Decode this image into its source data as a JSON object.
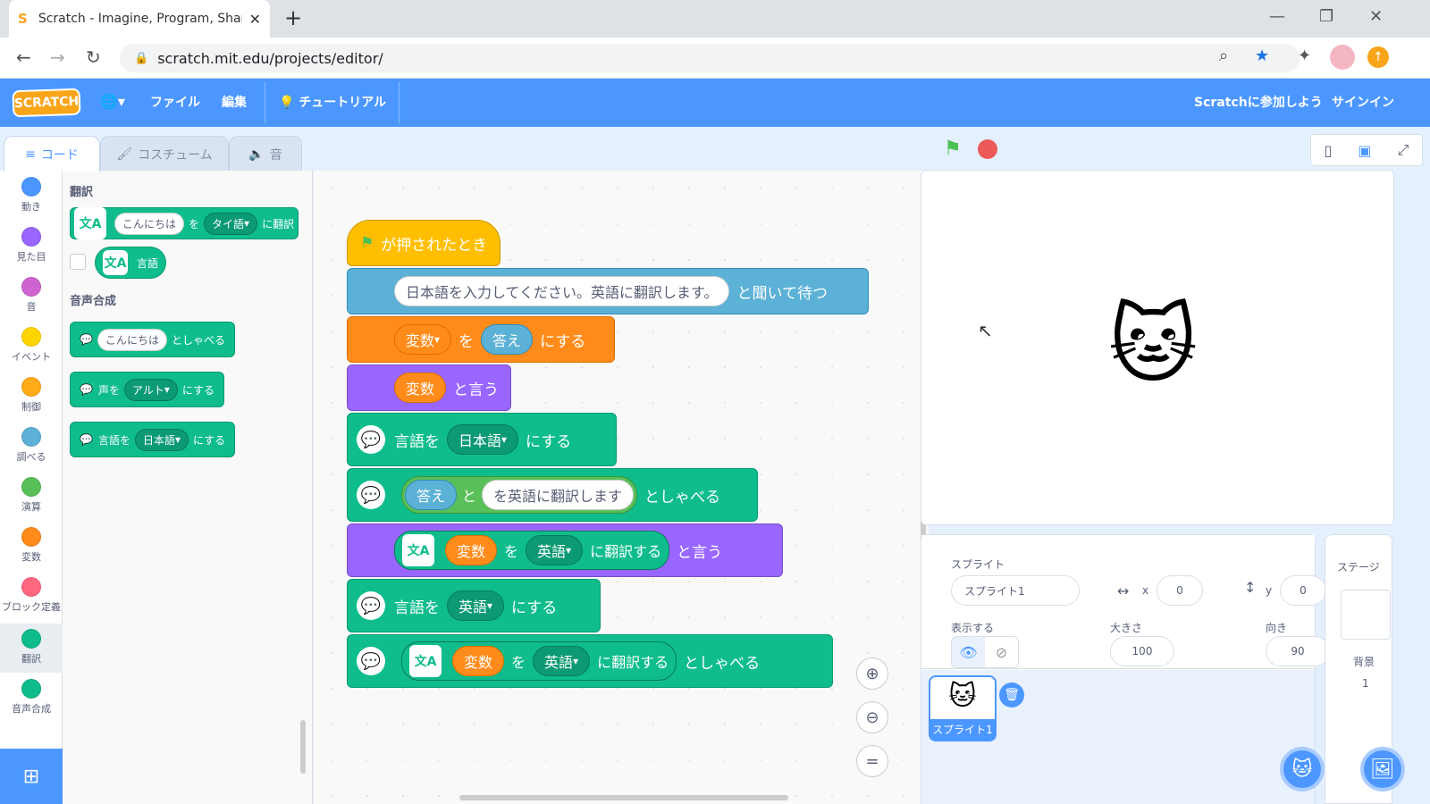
{
  "browser": {
    "tab_title": "Scratch - Imagine, Program, Share",
    "tab_close": "✕",
    "new_tab": "+",
    "url": "scratch.mit.edu/projects/editor/",
    "window": {
      "minimize": "—",
      "restore": "❐",
      "close": "✕"
    }
  },
  "menubar": {
    "logo": "SCRATCH",
    "language_icon": "🌐▾",
    "file": "ファイル",
    "edit": "編集",
    "tutorial": "チュートリアル",
    "join": "Scratchに参加しよう",
    "signin": "サインイン"
  },
  "tabs": {
    "code": "コード",
    "costume": "コスチューム",
    "sound": "音"
  },
  "categories": [
    {
      "label": "動き",
      "color": "#4c97ff"
    },
    {
      "label": "見た目",
      "color": "#9966ff"
    },
    {
      "label": "音",
      "color": "#cf63cf"
    },
    {
      "label": "イベント",
      "color": "#ffd500"
    },
    {
      "label": "制御",
      "color": "#ffab19"
    },
    {
      "label": "調べる",
      "color": "#5cb1d6"
    },
    {
      "label": "演算",
      "color": "#59c059"
    },
    {
      "label": "変数",
      "color": "#ff8c1a"
    },
    {
      "label": "ブロック定義",
      "color": "#ff6680"
    },
    {
      "label": "翻訳",
      "color": "#0fbd8c"
    },
    {
      "label": "音声合成",
      "color": "#0fbd8c"
    }
  ],
  "palette": {
    "translate_heading": "翻訳",
    "translate_block": {
      "text": "こんにちは",
      "mid": "を",
      "lang": "タイ語",
      "end": "に翻訳"
    },
    "language_reporter": "言語",
    "tts_heading": "音声合成",
    "speak_block": {
      "text": "こんにちは",
      "end": "としゃべる"
    },
    "voice_block": {
      "start": "声を",
      "voice": "アルト",
      "end": "にする"
    },
    "lang_block": {
      "start": "言語を",
      "lang": "日本語",
      "end": "にする"
    }
  },
  "script": {
    "hat": "が押されたとき",
    "ask": {
      "text": "日本語を入力してください。英語に翻訳します。",
      "end": "と聞いて待つ"
    },
    "set_var": {
      "var": "変数",
      "mid": "を",
      "val": "答え",
      "end": "にする"
    },
    "say_var": {
      "var": "変数",
      "end": "と言う"
    },
    "set_lang_ja": {
      "start": "言語を",
      "lang": "日本語",
      "end": "にする"
    },
    "speak_join": {
      "a": "答え",
      "mid": "と",
      "b": "を英語に翻訳します",
      "end": "としゃべる"
    },
    "say_translate": {
      "var": "変数",
      "mid": "を",
      "lang": "英語",
      "tr": "に翻訳する",
      "end": "と言う"
    },
    "set_lang_en": {
      "start": "言語を",
      "lang": "英語",
      "end": "にする"
    },
    "speak_translate": {
      "var": "変数",
      "mid": "を",
      "lang": "英語",
      "tr": "に翻訳する",
      "end": "としゃべる"
    }
  },
  "sprite_info": {
    "sprite_label": "スプライト",
    "sprite_name": "スプライト1",
    "x_label": "x",
    "x": "0",
    "y_label": "y",
    "y": "0",
    "show_label": "表示する",
    "size_label": "大きさ",
    "size": "100",
    "direction_label": "向き",
    "direction": "90"
  },
  "sprite_thumb": "スプライト1",
  "stage_panel": {
    "title": "ステージ",
    "backdrop_label": "背景",
    "backdrop_count": "1"
  }
}
